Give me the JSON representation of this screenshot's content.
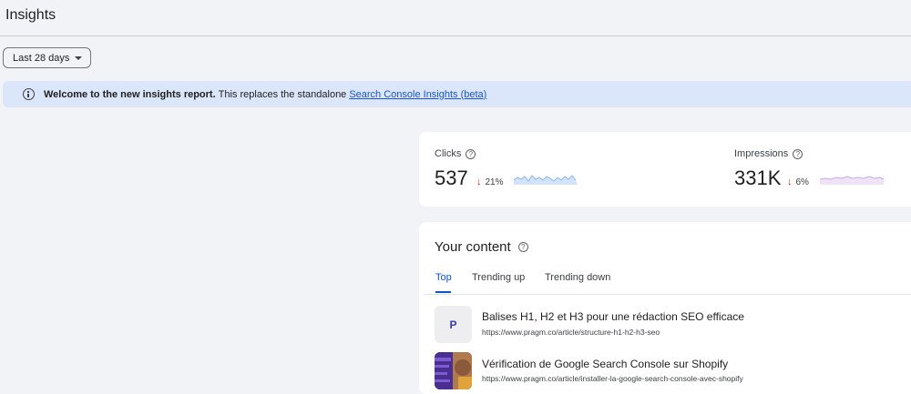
{
  "page": {
    "title": "Insights"
  },
  "date_range": {
    "selected": "Last 28 days"
  },
  "banner": {
    "bold_text": "Welcome to the new insights report.",
    "text": "This replaces the standalone",
    "link": "Search Console Insights (beta)"
  },
  "metrics": {
    "clicks": {
      "label": "Clicks",
      "value": "537",
      "delta": "21%",
      "direction": "down",
      "color": "#8ab4f8"
    },
    "impressions": {
      "label": "Impressions",
      "value": "331K",
      "delta": "6%",
      "direction": "down",
      "color": "#c9a9e6"
    }
  },
  "content": {
    "title": "Your content",
    "tabs": [
      "Top",
      "Trending up",
      "Trending down"
    ],
    "active_tab": "Top",
    "items": [
      {
        "thumb_letter": "P",
        "title": "Balises H1, H2 et H3 pour une rédaction SEO efficace",
        "url": "https://www.pragm.co/article/structure-h1-h2-h3-seo"
      },
      {
        "thumb_letter": "",
        "title": "Vérification de Google Search Console sur Shopify",
        "url": "https://www.pragm.co/article/installer-la-google-search-console-avec-shopify"
      }
    ]
  },
  "colors": {
    "accent": "#0b57d0",
    "banner_bg": "#dbe6fb",
    "down": "#c5221f"
  }
}
